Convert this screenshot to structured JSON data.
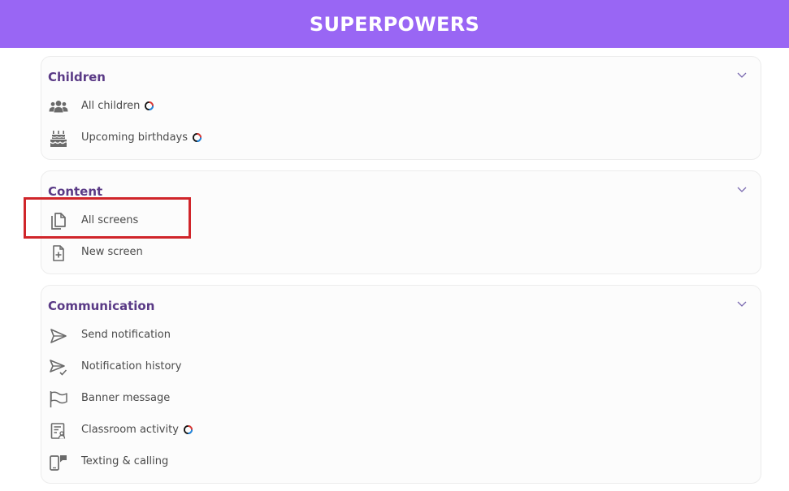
{
  "header": {
    "title": "SUPERPOWERS"
  },
  "colors": {
    "brand": "#9966f4",
    "section_title": "#5a3a86",
    "highlight": "#d0252a"
  },
  "sections": [
    {
      "title": "Children",
      "items": [
        {
          "label": "All children",
          "icon": "users-icon",
          "badge": true
        },
        {
          "label": "Upcoming birthdays",
          "icon": "birthday-cake-icon",
          "badge": true
        }
      ]
    },
    {
      "title": "Content",
      "items": [
        {
          "label": "All screens",
          "icon": "copy-pages-icon",
          "badge": false,
          "highlighted": true
        },
        {
          "label": "New screen",
          "icon": "file-plus-icon",
          "badge": false
        }
      ]
    },
    {
      "title": "Communication",
      "items": [
        {
          "label": "Send notification",
          "icon": "send-icon",
          "badge": false
        },
        {
          "label": "Notification history",
          "icon": "send-check-icon",
          "badge": false
        },
        {
          "label": "Banner message",
          "icon": "flag-icon",
          "badge": false
        },
        {
          "label": "Classroom activity",
          "icon": "classroom-report-icon",
          "badge": true
        },
        {
          "label": "Texting & calling",
          "icon": "phone-chat-icon",
          "badge": false
        }
      ]
    }
  ]
}
